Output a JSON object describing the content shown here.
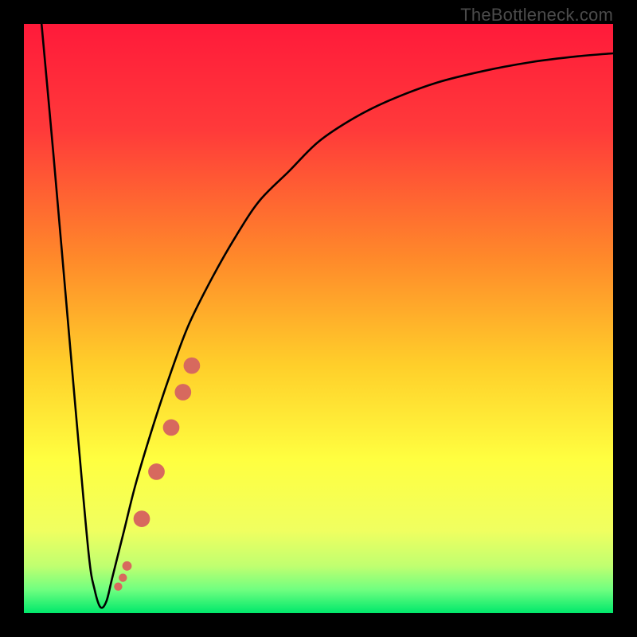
{
  "watermark": "TheBottleneck.com",
  "gradient": {
    "stops": [
      {
        "pct": 0,
        "color": "#ff1a3a"
      },
      {
        "pct": 18,
        "color": "#ff3a3a"
      },
      {
        "pct": 40,
        "color": "#ff8a2a"
      },
      {
        "pct": 58,
        "color": "#ffcf2a"
      },
      {
        "pct": 74,
        "color": "#ffff40"
      },
      {
        "pct": 86,
        "color": "#f0ff60"
      },
      {
        "pct": 92,
        "color": "#c0ff70"
      },
      {
        "pct": 96,
        "color": "#70ff80"
      },
      {
        "pct": 100,
        "color": "#00e86b"
      }
    ]
  },
  "chart_data": {
    "type": "line",
    "title": "",
    "xlabel": "",
    "ylabel": "",
    "xlim": [
      0,
      100
    ],
    "ylim": [
      0,
      100
    ],
    "series": [
      {
        "name": "bottleneck-curve",
        "x": [
          3,
          5,
          7,
          9,
          11,
          12,
          13,
          14,
          15,
          17,
          19,
          22,
          25,
          28,
          32,
          36,
          40,
          45,
          50,
          56,
          62,
          70,
          78,
          86,
          94,
          100
        ],
        "y": [
          100,
          78,
          55,
          32,
          10,
          4,
          1,
          2,
          6,
          14,
          22,
          32,
          41,
          49,
          57,
          64,
          70,
          75,
          80,
          84,
          87,
          90,
          92,
          93.5,
          94.5,
          95
        ]
      }
    ],
    "markers": {
      "name": "highlight-band",
      "color": "#d7695e",
      "points": [
        {
          "x": 16.0,
          "y": 4.5,
          "r": 0.7
        },
        {
          "x": 16.8,
          "y": 6.0,
          "r": 0.7
        },
        {
          "x": 17.5,
          "y": 8.0,
          "r": 0.8
        },
        {
          "x": 20.0,
          "y": 16.0,
          "r": 1.4
        },
        {
          "x": 22.5,
          "y": 24.0,
          "r": 1.4
        },
        {
          "x": 25.0,
          "y": 31.5,
          "r": 1.4
        },
        {
          "x": 27.0,
          "y": 37.5,
          "r": 1.4
        },
        {
          "x": 28.5,
          "y": 42.0,
          "r": 1.4
        }
      ]
    }
  }
}
